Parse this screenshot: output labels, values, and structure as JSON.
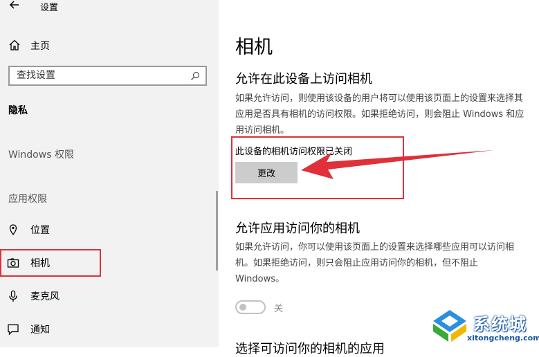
{
  "window": {
    "title": "设置"
  },
  "sidebar": {
    "home_label": "主页",
    "search_placeholder": "查找设置",
    "section_privacy": "隐私",
    "section_windows_permissions": "Windows 权限",
    "section_app_permissions": "应用权限",
    "items": [
      {
        "label": "位置",
        "icon": "location-icon"
      },
      {
        "label": "相机",
        "icon": "camera-icon",
        "selected": true
      },
      {
        "label": "麦克风",
        "icon": "microphone-icon"
      },
      {
        "label": "通知",
        "icon": "notification-icon"
      }
    ]
  },
  "main": {
    "title": "相机",
    "device_access": {
      "heading": "允许在此设备上访问相机",
      "desc_lines": [
        "如果允许访问，则使用该设备的用户将可以使用该页面上的设置来选择其",
        "应用是否具有相机的访问权限。如果拒绝访问，则会阻止 Windows 和应",
        "用访问相机。"
      ],
      "status": "此设备的相机访问权限已关闭",
      "change_label": "更改"
    },
    "app_access": {
      "heading": "允许应用访问你的相机",
      "desc_lines": [
        "如果允许访问，你可以使用该页面上的设置来选择哪些应用可以访问相",
        "机。如果拒绝访问，则只会阻止应用访问你的相机，但不阻止",
        "Windows。"
      ],
      "toggle_label": "关",
      "toggle_on": false
    },
    "next_heading": "选择可访问你的相机的应用"
  },
  "watermark": {
    "brand": "系统城",
    "url": "xitongcheng.com"
  },
  "colors": {
    "annotation": "#e0303a",
    "sidebar_bg": "#f2f2f2",
    "button_bg": "#cccccc",
    "watermark_blue": "#1a5aa6"
  }
}
